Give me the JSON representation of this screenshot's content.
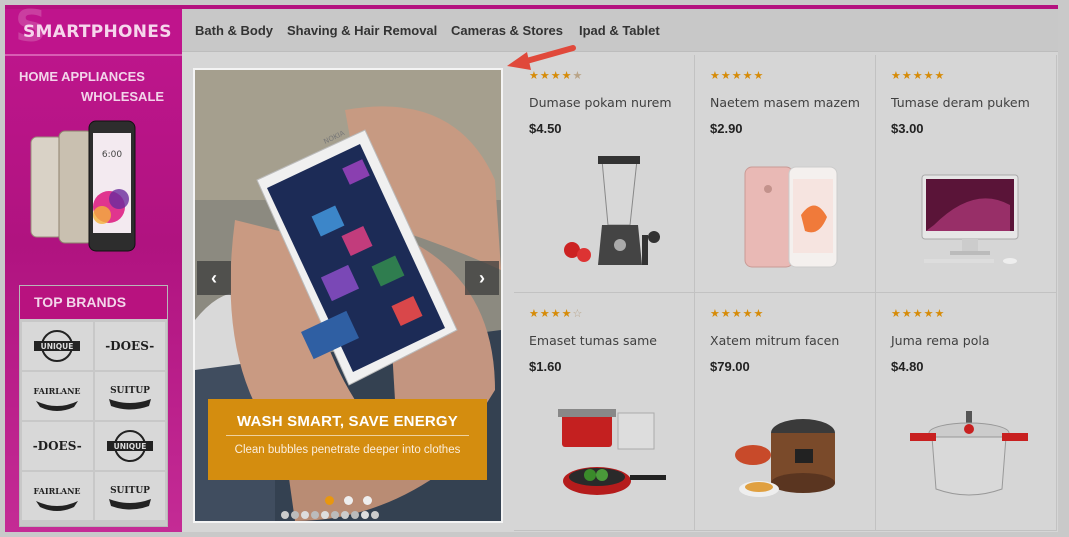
{
  "sidebar": {
    "category_title": "SMARTPHONES",
    "banner_line1": "HOME APPLIANCES",
    "banner_line2": "WHOLESALE",
    "brands_title": "TOP BRANDS",
    "brands": [
      "UNIQUE",
      "-DOES-",
      "FAIRLANE",
      "SUITUP",
      "-DOES-",
      "UNIQUE",
      "FAIRLANE",
      "SUITUP"
    ]
  },
  "nav": {
    "items": [
      "Bath & Body",
      "Shaving & Hair Removal",
      "Cameras & Stores",
      "Ipad & Tablet"
    ]
  },
  "slider": {
    "caption_title": "WASH SMART, SAVE ENERGY",
    "caption_subtitle": "Clean bubbles penetrate deeper into clothes",
    "prev_glyph": "‹",
    "next_glyph": "›",
    "active_slide": 1,
    "slide_count": 3,
    "phone_brand": "NOKIA"
  },
  "products": [
    {
      "name": "Dumase pokam nurem",
      "price": "$4.50",
      "rating": 4.5,
      "image": "blender"
    },
    {
      "name": "Naetem masem mazem",
      "price": "$2.90",
      "rating": 5,
      "image": "iphone-rose-gold"
    },
    {
      "name": "Tumase deram pukem",
      "price": "$3.00",
      "rating": 5,
      "image": "imac"
    },
    {
      "name": "Emaset tumas same",
      "price": "$1.60",
      "rating": 4,
      "image": "cookware-set"
    },
    {
      "name": "Xatem mitrum facen",
      "price": "$79.00",
      "rating": 5,
      "image": "rice-cooker"
    },
    {
      "name": "Juma rema pola",
      "price": "$4.80",
      "rating": 5,
      "image": "pressure-cooker"
    }
  ],
  "colors": {
    "accent_magenta": "#b4127f",
    "caption_orange": "#d48d0f",
    "star": "#d68b08",
    "pointer_red": "#e0493b"
  }
}
